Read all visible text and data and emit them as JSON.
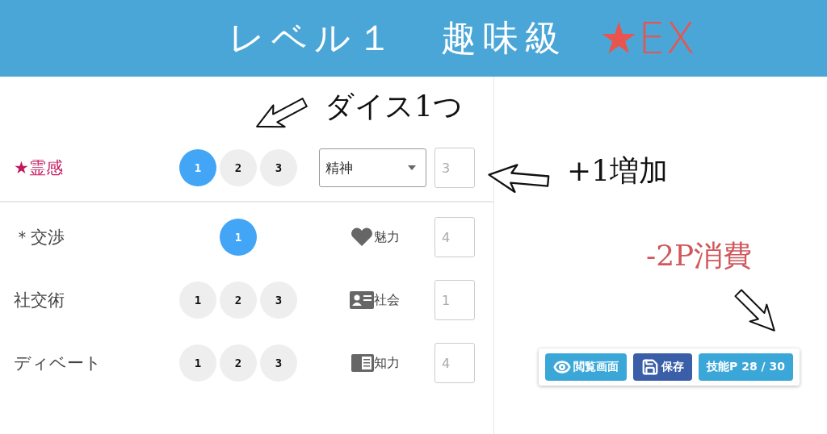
{
  "header": {
    "title": "レベル１　趣味級",
    "badge": "★EX"
  },
  "skills": [
    {
      "name": "★霊感",
      "highlighted": true,
      "dice": [
        {
          "label": "1",
          "selected": true
        },
        {
          "label": "2",
          "selected": false
        },
        {
          "label": "3",
          "selected": false
        }
      ],
      "attribute": {
        "kind": "select",
        "label": "精神"
      },
      "score": "3"
    },
    {
      "name": "＊交渉",
      "highlighted": false,
      "dice": [
        {
          "label": "1",
          "selected": true
        }
      ],
      "attribute": {
        "kind": "heart",
        "label": "魅力"
      },
      "score": "4"
    },
    {
      "name": "社交術",
      "highlighted": false,
      "dice": [
        {
          "label": "1",
          "selected": false
        },
        {
          "label": "2",
          "selected": false
        },
        {
          "label": "3",
          "selected": false
        }
      ],
      "attribute": {
        "kind": "card",
        "label": "社会"
      },
      "score": "1"
    },
    {
      "name": "ディベート",
      "highlighted": false,
      "dice": [
        {
          "label": "1",
          "selected": false
        },
        {
          "label": "2",
          "selected": false
        },
        {
          "label": "3",
          "selected": false
        }
      ],
      "attribute": {
        "kind": "book",
        "label": "知力"
      },
      "score": "4"
    }
  ],
  "footer_buttons": [
    {
      "kind": "view",
      "label": "閲覧画面"
    },
    {
      "kind": "save",
      "label": "保存"
    },
    {
      "kind": "points",
      "label": "技能P 28 / 30"
    }
  ],
  "annotations": [
    {
      "text": "ダイス1つ",
      "color": "#111111"
    },
    {
      "text": "+1増加",
      "color": "#111111"
    },
    {
      "text": "-2P消費",
      "color": "#d0575a"
    }
  ]
}
